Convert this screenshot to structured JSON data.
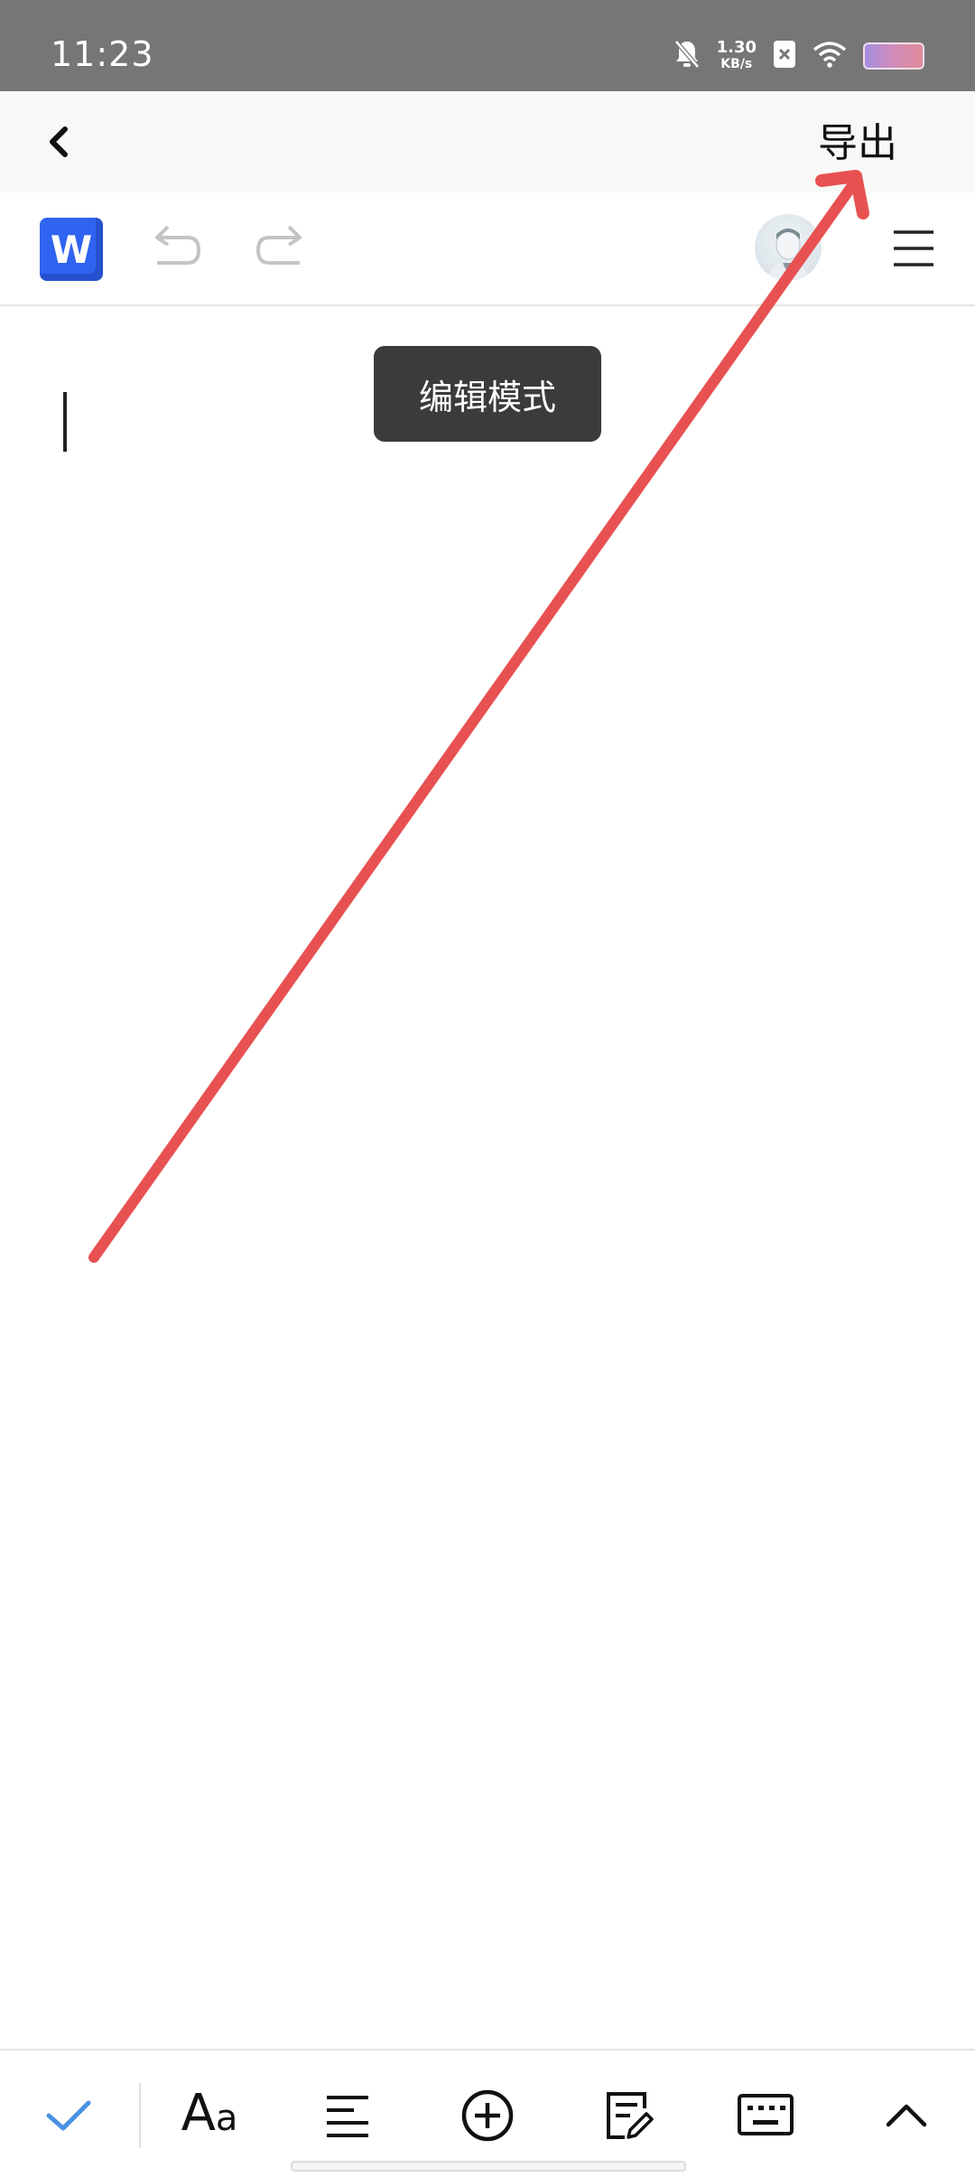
{
  "status_bar": {
    "time": "11:23",
    "net_speed_value": "1.30",
    "net_speed_unit": "KB/s",
    "icons": [
      "bell-off-icon",
      "sim-x-icon",
      "wifi-icon",
      "battery-icon"
    ]
  },
  "top_bar": {
    "back_icon": "chevron-left-icon",
    "export_label": "导出"
  },
  "toolbar": {
    "app_logo_letter": "W",
    "undo_icon": "undo-icon",
    "redo_icon": "redo-icon",
    "avatar_icon": "user-avatar",
    "menu_icon": "hamburger-menu-icon"
  },
  "document": {
    "toast_text": "编辑模式",
    "content": ""
  },
  "annotation": {
    "arrow_color": "#e85151",
    "arrow_target": "export-button"
  },
  "bottom_toolbar": {
    "items": [
      {
        "icon": "check-icon",
        "color": "#4a90e2"
      },
      {
        "icon": "font-style-icon",
        "label_big": "A",
        "label_small": "a"
      },
      {
        "icon": "align-left-icon"
      },
      {
        "icon": "insert-plus-icon"
      },
      {
        "icon": "edit-note-icon"
      },
      {
        "icon": "keyboard-icon"
      },
      {
        "icon": "chevron-up-icon"
      }
    ]
  },
  "colors": {
    "status_bar_bg": "#767676",
    "top_bar_bg": "#f8f8f8",
    "word_blue": "#2f63f0",
    "toast_bg": "#3b3b3b"
  }
}
